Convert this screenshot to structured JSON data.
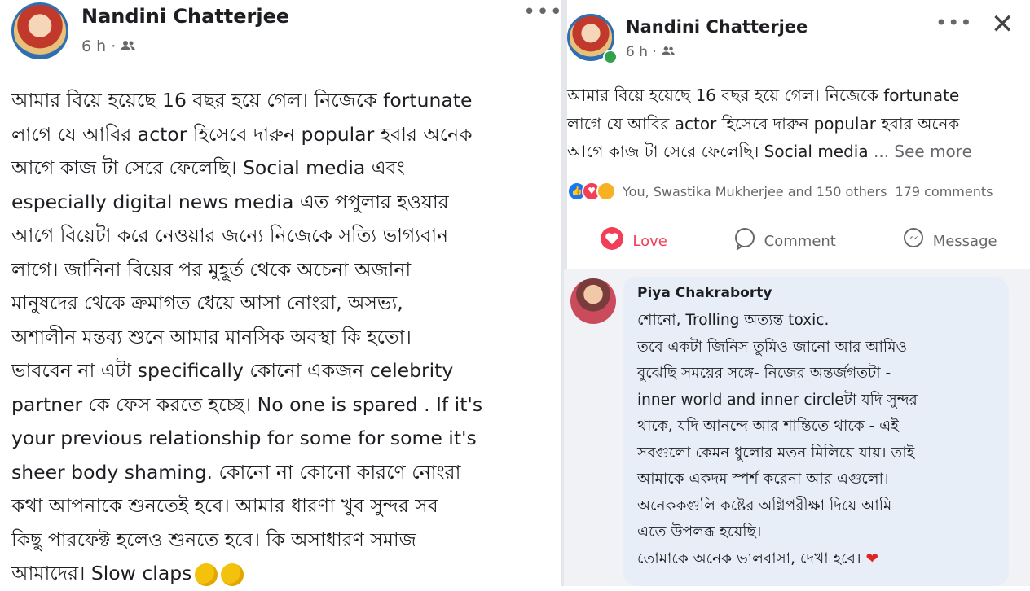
{
  "left_post": {
    "author": "Nandini Chatterjee",
    "time": "6 h ·",
    "audience_icon": "friends-icon",
    "more_icon": "•••",
    "body": "আমার বিয়ে হয়েছে 16 বছর হয়ে গেল। নিজেকে fortunate\nলাগে যে আবির actor হিসেবে দারুন popular হবার অনেক\nআগে কাজ টা সেরে ফেলেছি। Social media এবং\nespecially digital news media এত পপুলার হওয়ার\nআগে বিয়েটা করে নেওয়ার জন্যে নিজেকে সত্যি ভাগ্যবান\nলাগে। জানিনা বিয়ের পর মুহূর্ত থেকে অচেনা অজানা\nমানুষদের থেকে ক্রমাগত ধেয়ে আসা নোংরা, অসভ্য,\nঅশালীন মন্তব্য শুনে আমার মানসিক অবস্থা কি হতো।\nভাববেন না এটা specifically কোনো একজন celebrity\npartner কে ফেস করতে হচ্ছে। No one is spared . If it's\nyour previous relationship for some for some it's\nsheer body shaming. কোনো না কোনো কারণে নোংরা\nকথা আপনাকে শুনতেই হবে। আমার ধারণা খুব সুন্দর সব\nকিছু পারফেক্ট হলেও শুনতে হবে। কি অসাধারণ সমাজ\nআমাদের। Slow claps"
  },
  "right_post": {
    "author": "Nandini Chatterjee",
    "time": "6 h ·",
    "more_icon": "•••",
    "close_icon": "✕",
    "body": "আমার বিয়ে হয়েছে 16 বছর হয়ে গেল। নিজেকে fortunate\nলাগে যে আবির actor হিসেবে দারুন popular হবার অনেক\nআগে কাজ টা সেরে ফেলেছি। Social media ",
    "see_more": "... See more",
    "reactions_text": "You, Swastika Mukherjee and 150 others",
    "comments_count": "179 comments",
    "actions": {
      "love": "Love",
      "comment": "Comment",
      "message": "Message"
    },
    "comment": {
      "author": "Piya Chakraborty",
      "text": "শোনো, Trolling অত্যন্ত toxic.\nতবে একটা জিনিস তুমিও জানো আর আমিও\nবুঝেছি সময়ের সঙ্গে- নিজের অন্তর্জগতটা -\ninner world and inner circleটা যদি সুন্দর\nথাকে, যদি আনন্দে আর শান্তিতে থাকে - এই\nসবগুলো কেমন ধুলোর মতন মিলিয়ে যায়। তাই\nআমাকে একদম স্পর্শ করেনা আর এগুলো।\nঅনেককগুলি কষ্টের অগ্নিপরীক্ষা দিয়ে আমি\nএতে উপলব্ধ হয়েছি।\nতোমাকে অনেক ভালবাসা, দেখা হবে।"
    }
  },
  "colors": {
    "love": "#f33e58",
    "like": "#1877f2",
    "muted": "#65676b",
    "comment_bg": "#e8eef8"
  }
}
